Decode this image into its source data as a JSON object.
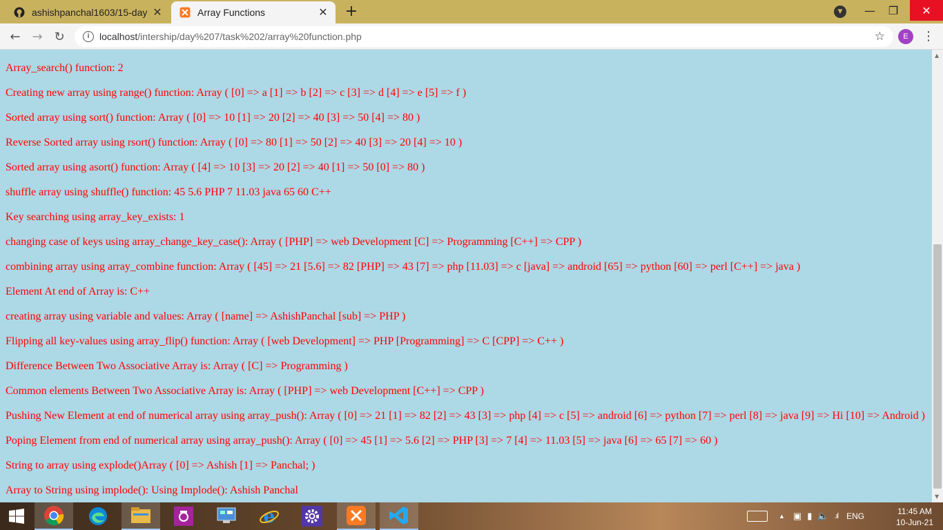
{
  "browser": {
    "tabs": [
      {
        "title": "ashishpanchal1603/15-day",
        "icon": "github-icon",
        "active": false
      },
      {
        "title": "Array Functions",
        "icon": "xampp-icon",
        "active": true
      }
    ],
    "url_host": "localhost",
    "url_path": "/intership/day%207/task%202/array%20function.php",
    "profile_initial": "E",
    "profile_color": "#a142c4"
  },
  "page": {
    "background": "#add8e6",
    "text_color": "#ff0000",
    "lines": [
      "Array_search() function: 2",
      "Creating new array using range() function: Array ( [0] => a [1] => b [2] => c [3] => d [4] => e [5] => f )",
      "Sorted array using sort() function: Array ( [0] => 10 [1] => 20 [2] => 40 [3] => 50 [4] => 80 )",
      "Reverse Sorted array using rsort() function: Array ( [0] => 80 [1] => 50 [2] => 40 [3] => 20 [4] => 10 )",
      "Sorted array using asort() function: Array ( [4] => 10 [3] => 20 [2] => 40 [1] => 50 [0] => 80 )",
      "shuffle array using shuffle() function: 45 5.6 PHP 7 11.03 java 65 60 C++",
      "Key searching using array_key_exists: 1",
      "changing case of keys using array_change_key_case(): Array ( [PHP] => web Development [C] => Programming [C++] => CPP )",
      "combining array using array_combine function: Array ( [45] => 21 [5.6] => 82 [PHP] => 43 [7] => php [11.03] => c [java] => android [65] => python [60] => perl [C++] => java )",
      "Element At end of Array is: C++",
      "creating array using variable and values: Array ( [name] => AshishPanchal [sub] => PHP )",
      "Flipping all key-values using array_flip() function: Array ( [web Development] => PHP [Programming] => C [CPP] => C++ )",
      "Difference Between Two Associative Array is: Array ( [C] => Programming )",
      "Common elements Between Two Associative Array is: Array ( [PHP] => web Development [C++] => CPP )",
      "Pushing New Element at end of numerical array using array_push(): Array ( [0] => 21 [1] => 82 [2] => 43 [3] => php [4] => c [5] => android [6] => python [7] => perl [8] => java [9] => Hi [10] => Android )",
      "Poping Element from end of numerical array using array_push(): Array ( [0] => 45 [1] => 5.6 [2] => PHP [3] => 7 [4] => 11.03 [5] => java [6] => 65 [7] => 60 )",
      "String to array using explode()Array ( [0] => Ashish [1] => Panchal; )",
      "Array to String using implode(): Using Implode(): Ashish Panchal"
    ]
  },
  "taskbar": {
    "apps": [
      {
        "name": "chrome-icon",
        "open": true
      },
      {
        "name": "edge-icon",
        "open": false
      },
      {
        "name": "file-explorer-icon",
        "open": true
      },
      {
        "name": "camera-icon",
        "open": false
      },
      {
        "name": "control-panel-icon",
        "open": false
      },
      {
        "name": "internet-explorer-icon",
        "open": false
      },
      {
        "name": "settings-icon",
        "open": false
      },
      {
        "name": "xampp-icon",
        "open": true
      },
      {
        "name": "vscode-icon",
        "open": true
      }
    ],
    "language": "ENG",
    "time": "11:45 AM",
    "date": "10-Jun-21"
  }
}
